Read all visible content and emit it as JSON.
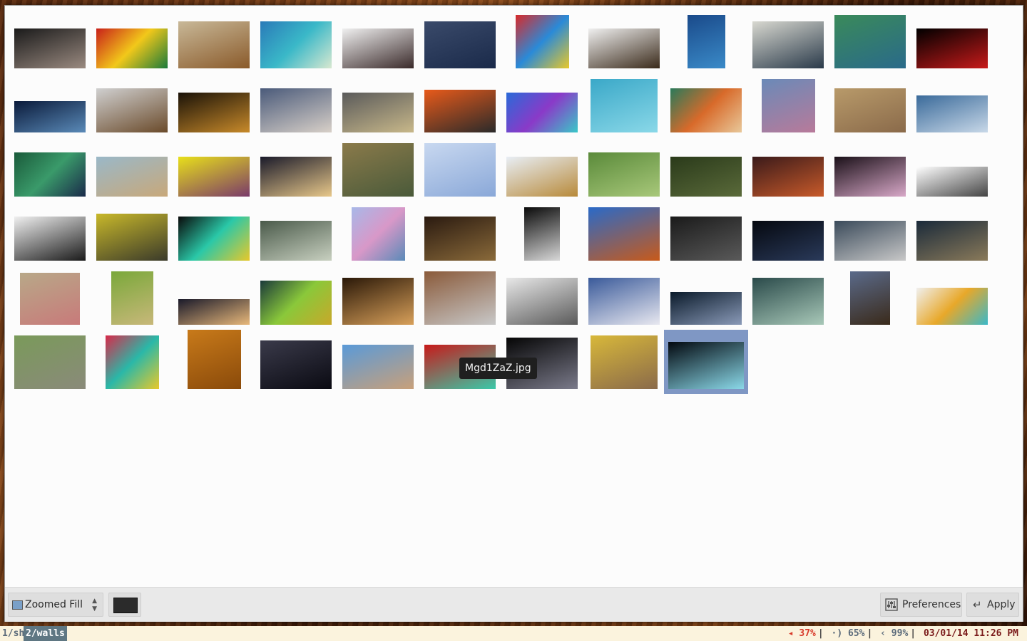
{
  "window": {
    "tooltip": "Mgd1ZaZ.jpg",
    "selected_index": 68
  },
  "thumbnails": [
    {
      "name": "smoking-man",
      "colors": [
        "#1a1a1a",
        "#9a8a80"
      ]
    },
    {
      "name": "colorful-stripes",
      "colors": [
        "#c8201a",
        "#f2c81a",
        "#1a7a3a"
      ]
    },
    {
      "name": "plains-mountain",
      "colors": [
        "#c8b898",
        "#8a5a2a"
      ]
    },
    {
      "name": "island-aerial",
      "colors": [
        "#2a7ab8",
        "#3ab8c8",
        "#d8e8d0"
      ]
    },
    {
      "name": "business-laugh",
      "colors": [
        "#f0f0f0",
        "#3a2a2a"
      ]
    },
    {
      "name": "skyscraper-fog",
      "colors": [
        "#3a4a6a",
        "#1a2a4a"
      ]
    },
    {
      "name": "colorful-polygons",
      "colors": [
        "#d82a2a",
        "#2a8ad8",
        "#e8c82a"
      ]
    },
    {
      "name": "floating-island",
      "colors": [
        "#f0f0f0",
        "#3a2a1a"
      ]
    },
    {
      "name": "fish-school",
      "colors": [
        "#1a4a8a",
        "#3a8ac8"
      ]
    },
    {
      "name": "ocean-wave",
      "colors": [
        "#d8d8d0",
        "#2a3a4a"
      ]
    },
    {
      "name": "sea-cliffs",
      "colors": [
        "#3a8a5a",
        "#2a6a8a"
      ]
    },
    {
      "name": "dark-saber",
      "colors": [
        "#000000",
        "#c81a1a"
      ]
    },
    {
      "name": "lake-shore",
      "colors": [
        "#0a1a3a",
        "#5a8ab8"
      ]
    },
    {
      "name": "hawks",
      "colors": [
        "#d0d0d0",
        "#6a4a2a"
      ]
    },
    {
      "name": "lightning-dark",
      "colors": [
        "#1a1208",
        "#c88a2a"
      ]
    },
    {
      "name": "clouds-space",
      "colors": [
        "#4a5a7a",
        "#d8d0c8"
      ]
    },
    {
      "name": "tv-wall",
      "colors": [
        "#5a5a5a",
        "#c8b88a"
      ]
    },
    {
      "name": "lava-flow",
      "colors": [
        "#e85a1a",
        "#2a2a2a"
      ]
    },
    {
      "name": "app-logo",
      "colors": [
        "#2a6ad8",
        "#8a3ac8",
        "#3ac8c8"
      ]
    },
    {
      "name": "underwater-tank",
      "colors": [
        "#3aa8c8",
        "#8ad8e8"
      ]
    },
    {
      "name": "retro-circles",
      "colors": [
        "#2a7a5a",
        "#d86a2a",
        "#e8c89a"
      ]
    },
    {
      "name": "hex-pattern",
      "colors": [
        "#6a8ab8",
        "#b87a9a"
      ]
    },
    {
      "name": "city-aerial",
      "colors": [
        "#b89a6a",
        "#8a6a4a"
      ]
    },
    {
      "name": "beach-storm",
      "colors": [
        "#3a6a9a",
        "#c8d8e8"
      ]
    },
    {
      "name": "batman-poly",
      "colors": [
        "#1a5a3a",
        "#3a9a6a",
        "#1a2a4a"
      ]
    },
    {
      "name": "ice-rock",
      "colors": [
        "#9ab8c8",
        "#c8a87a"
      ]
    },
    {
      "name": "yellow-beast",
      "colors": [
        "#e8e01a",
        "#7a3a6a"
      ]
    },
    {
      "name": "sunrise-dome",
      "colors": [
        "#1a1a2a",
        "#e8c88a"
      ]
    },
    {
      "name": "mountain-valley",
      "colors": [
        "#8a7a4a",
        "#4a5a3a"
      ]
    },
    {
      "name": "frost-web",
      "colors": [
        "#c8d8f0",
        "#8aa8d8"
      ]
    },
    {
      "name": "food-plate",
      "colors": [
        "#e8eef5",
        "#b88a3a"
      ]
    },
    {
      "name": "romanesco",
      "colors": [
        "#5a8a3a",
        "#a8c87a"
      ]
    },
    {
      "name": "jungle-ruins",
      "colors": [
        "#2a3a1a",
        "#5a6a3a"
      ]
    },
    {
      "name": "rusty-car",
      "colors": [
        "#3a1a1a",
        "#c85a2a"
      ]
    },
    {
      "name": "fellowship",
      "colors": [
        "#1a1018",
        "#d8a8c8"
      ]
    },
    {
      "name": "minimal-tree",
      "colors": [
        "#ffffff",
        "#444444"
      ]
    },
    {
      "name": "pirate-ship",
      "colors": [
        "#f0f0f0",
        "#1a1a1a"
      ]
    },
    {
      "name": "minions",
      "colors": [
        "#c8b82a",
        "#3a3a2a"
      ]
    },
    {
      "name": "typography",
      "colors": [
        "#0a0a0a",
        "#2ac8a8",
        "#e8c82a"
      ]
    },
    {
      "name": "ornament-green",
      "colors": [
        "#4a5a4a",
        "#c8d0c0"
      ]
    },
    {
      "name": "pastel-hex",
      "colors": [
        "#a8b8e8",
        "#d898c8",
        "#5a8ab8"
      ]
    },
    {
      "name": "gandalf",
      "colors": [
        "#2a1a10",
        "#8a6a3a"
      ]
    },
    {
      "name": "bridge-bw",
      "colors": [
        "#0a0a0a",
        "#d8d8d8"
      ]
    },
    {
      "name": "lake-reflection",
      "colors": [
        "#2a6ac8",
        "#c85a1a"
      ]
    },
    {
      "name": "dark-sphere",
      "colors": [
        "#1a1a1a",
        "#5a5a5a"
      ]
    },
    {
      "name": "night-road",
      "colors": [
        "#05080f",
        "#2a3a5a"
      ]
    },
    {
      "name": "mountain-cloud",
      "colors": [
        "#3a4a5a",
        "#c8c8c8"
      ]
    },
    {
      "name": "dark-flower",
      "colors": [
        "#1a2a3a",
        "#8a7a5a"
      ]
    },
    {
      "name": "floral-tile",
      "colors": [
        "#b8a888",
        "#c87a7a"
      ]
    },
    {
      "name": "forest-fairy",
      "colors": [
        "#7aa83a",
        "#c8b87a"
      ]
    },
    {
      "name": "city-night",
      "colors": [
        "#1a1a2a",
        "#e8b87a"
      ]
    },
    {
      "name": "green-circles",
      "colors": [
        "#1a3a3a",
        "#8ac83a",
        "#c8a82a"
      ]
    },
    {
      "name": "tunnel",
      "colors": [
        "#2a1808",
        "#d8a05a"
      ]
    },
    {
      "name": "city-roofs",
      "colors": [
        "#8a5a3a",
        "#c8c8c8"
      ]
    },
    {
      "name": "golden-gate",
      "colors": [
        "#e8e8e8",
        "#5a5a5a"
      ]
    },
    {
      "name": "greek-village",
      "colors": [
        "#3a5a9a",
        "#e8e8f0"
      ]
    },
    {
      "name": "fantasy-valley",
      "colors": [
        "#0a1a2a",
        "#8a9ab8"
      ]
    },
    {
      "name": "green-room",
      "colors": [
        "#2a4a4a",
        "#a8c8b8"
      ]
    },
    {
      "name": "tower-house",
      "colors": [
        "#5a6a8a",
        "#3a2a1a"
      ]
    },
    {
      "name": "suit-dots",
      "colors": [
        "#f0f0f0",
        "#e8a82a",
        "#3ab8c8"
      ]
    },
    {
      "name": "rail-bunker",
      "colors": [
        "#7a9a5a",
        "#8a8a7a"
      ]
    },
    {
      "name": "color-cubes",
      "colors": [
        "#d82a4a",
        "#2ab8a8",
        "#e8c82a"
      ]
    },
    {
      "name": "orange-pattern",
      "colors": [
        "#c87a1a",
        "#8a4a0a"
      ]
    },
    {
      "name": "night-coast",
      "colors": [
        "#3a3a4a",
        "#0a0a12"
      ]
    },
    {
      "name": "city-sky",
      "colors": [
        "#5a9ad8",
        "#c8a07a"
      ]
    },
    {
      "name": "red-green-blur",
      "colors": [
        "#c81a1a",
        "#3ac8a8"
      ]
    },
    {
      "name": "fractal-dark",
      "colors": [
        "#050505",
        "#7a7a8a"
      ]
    },
    {
      "name": "gold-stairs",
      "colors": [
        "#d8b83a",
        "#8a6a4a"
      ]
    },
    {
      "name": "sombrero-galaxy",
      "colors": [
        "#02080f",
        "#8ad8e8"
      ]
    }
  ],
  "bottom_bar": {
    "fill_mode": "Zoomed Fill",
    "fill_mode_icon": "monitor-icon",
    "background_color": "#2b2b2b",
    "preferences_label": "Preferences",
    "preferences_icon": "sliders-icon",
    "apply_label": "Apply",
    "apply_icon": "enter-icon"
  },
  "panel": {
    "workspaces": [
      "1/sh",
      "2/walls"
    ],
    "active_workspace": "2/walls",
    "volume": "37%",
    "signal": "65%",
    "battery": "99%",
    "datetime": "03/01/14 11:26 PM",
    "volume_color": "#d83a2a",
    "signal_color": "#5a6a7a",
    "battery_color": "#5a6a7a",
    "datetime_color": "#7a1a1a"
  }
}
